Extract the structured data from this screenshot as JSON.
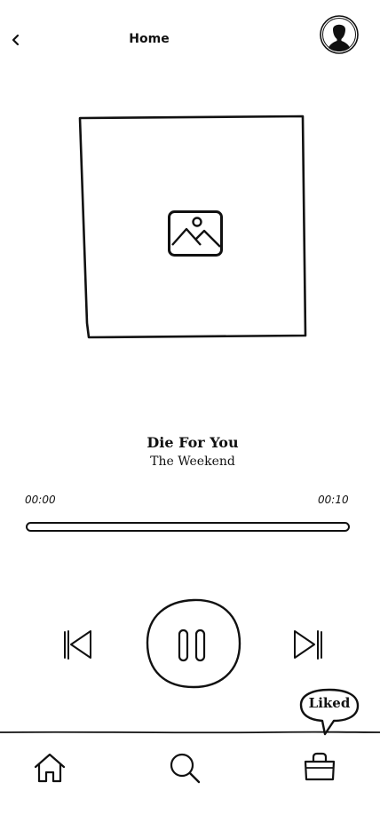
{
  "header": {
    "title": "Home",
    "back_icon": "chevron-left-icon",
    "avatar_icon": "user-avatar-icon"
  },
  "artwork": {
    "icon": "image-placeholder-icon"
  },
  "track": {
    "title": "Die For You",
    "artist": "The Weekend"
  },
  "progress": {
    "elapsed": "00:00",
    "duration": "00:10",
    "fraction": 0.0
  },
  "controls": {
    "previous_icon": "skip-previous-icon",
    "pause_icon": "pause-icon",
    "next_icon": "skip-next-icon",
    "state": "playing"
  },
  "tooltip": {
    "label": "Liked"
  },
  "bottom_nav": {
    "items": [
      {
        "icon": "home-icon"
      },
      {
        "icon": "search-icon"
      },
      {
        "icon": "liked-bag-icon",
        "active": true
      }
    ]
  },
  "colors": {
    "ink": "#111111",
    "background": "#ffffff"
  }
}
